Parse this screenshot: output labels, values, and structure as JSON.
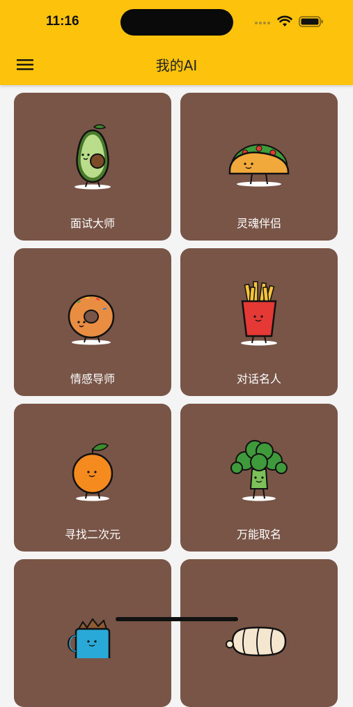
{
  "status": {
    "time": "11:16"
  },
  "header": {
    "title": "我的AI",
    "menu_icon": "hamburger-menu-icon"
  },
  "cards": [
    {
      "label": "面试大师",
      "icon": "avocado-icon"
    },
    {
      "label": "灵魂伴侣",
      "icon": "taco-icon"
    },
    {
      "label": "情感导师",
      "icon": "donut-icon"
    },
    {
      "label": "对话名人",
      "icon": "french-fries-icon"
    },
    {
      "label": "寻找二次元",
      "icon": "orange-icon"
    },
    {
      "label": "万能取名",
      "icon": "broccoli-icon"
    },
    {
      "label": "",
      "icon": "mug-icon"
    },
    {
      "label": "",
      "icon": "bread-icon"
    }
  ],
  "colors": {
    "header": "#fdc20b",
    "card": "#795548",
    "background": "#f4f4f4"
  }
}
